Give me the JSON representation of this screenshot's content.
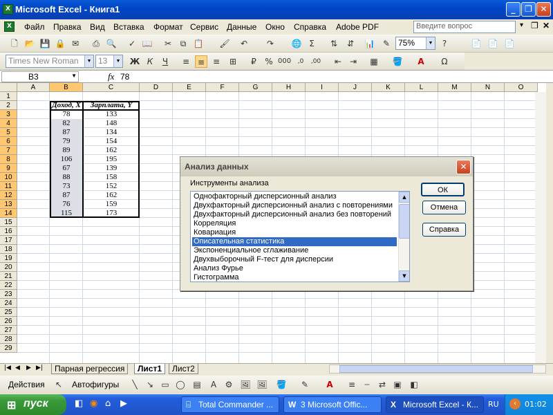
{
  "window": {
    "title": "Microsoft Excel - Книга1"
  },
  "menu": {
    "items": [
      "Файл",
      "Правка",
      "Вид",
      "Вставка",
      "Формат",
      "Сервис",
      "Данные",
      "Окно",
      "Справка",
      "Adobe PDF"
    ],
    "ask_placeholder": "Введите вопрос"
  },
  "toolbar": {
    "zoom": "75%",
    "font": "Times New Roman",
    "size": "13"
  },
  "formula_bar": {
    "cell_ref": "B3",
    "fx": "fx",
    "value": "78"
  },
  "columns": [
    "A",
    "B",
    "C",
    "D",
    "E",
    "F",
    "G",
    "H",
    "I",
    "J",
    "K",
    "L",
    "M",
    "N",
    "O"
  ],
  "rows": [
    "1",
    "2",
    "3",
    "4",
    "5",
    "6",
    "7",
    "8",
    "9",
    "10",
    "11",
    "12",
    "13",
    "14",
    "15",
    "16",
    "17",
    "18",
    "19",
    "20",
    "21",
    "22",
    "23",
    "24",
    "25",
    "26",
    "27",
    "28",
    "29"
  ],
  "table": {
    "header_x": "Доход, X",
    "header_y": "Зарплата, Y",
    "x": [
      "78",
      "82",
      "87",
      "79",
      "89",
      "106",
      "67",
      "88",
      "73",
      "87",
      "76",
      "115"
    ],
    "y": [
      "133",
      "148",
      "134",
      "154",
      "162",
      "195",
      "139",
      "158",
      "152",
      "162",
      "159",
      "173"
    ]
  },
  "dialog": {
    "title": "Анализ данных",
    "label": "Инструменты анализа",
    "tools": [
      "Однофакторный дисперсионный анализ",
      "Двухфакторный дисперсионный анализ с повторениями",
      "Двухфакторный дисперсионный анализ без повторений",
      "Корреляция",
      "Ковариация",
      "Описательная статистика",
      "Экспоненциальное сглаживание",
      "Двухвыборочный F-тест для дисперсии",
      "Анализ Фурье",
      "Гистограмма"
    ],
    "selected_index": 5,
    "ok": "ОК",
    "cancel": "Отмена",
    "help": "Справка"
  },
  "sheets": {
    "tabs": [
      "Парная регрессия",
      "Лист1",
      "Лист2"
    ],
    "active": "Лист1"
  },
  "drawing": {
    "actions": "Действия",
    "autoshapes": "Автофигуры"
  },
  "taskbar": {
    "start": "пуск",
    "items": [
      "Total Commander ...",
      "3 Microsoft Offic...",
      "Microsoft Excel - К..."
    ],
    "lang": "RU",
    "clock": "01:02"
  }
}
